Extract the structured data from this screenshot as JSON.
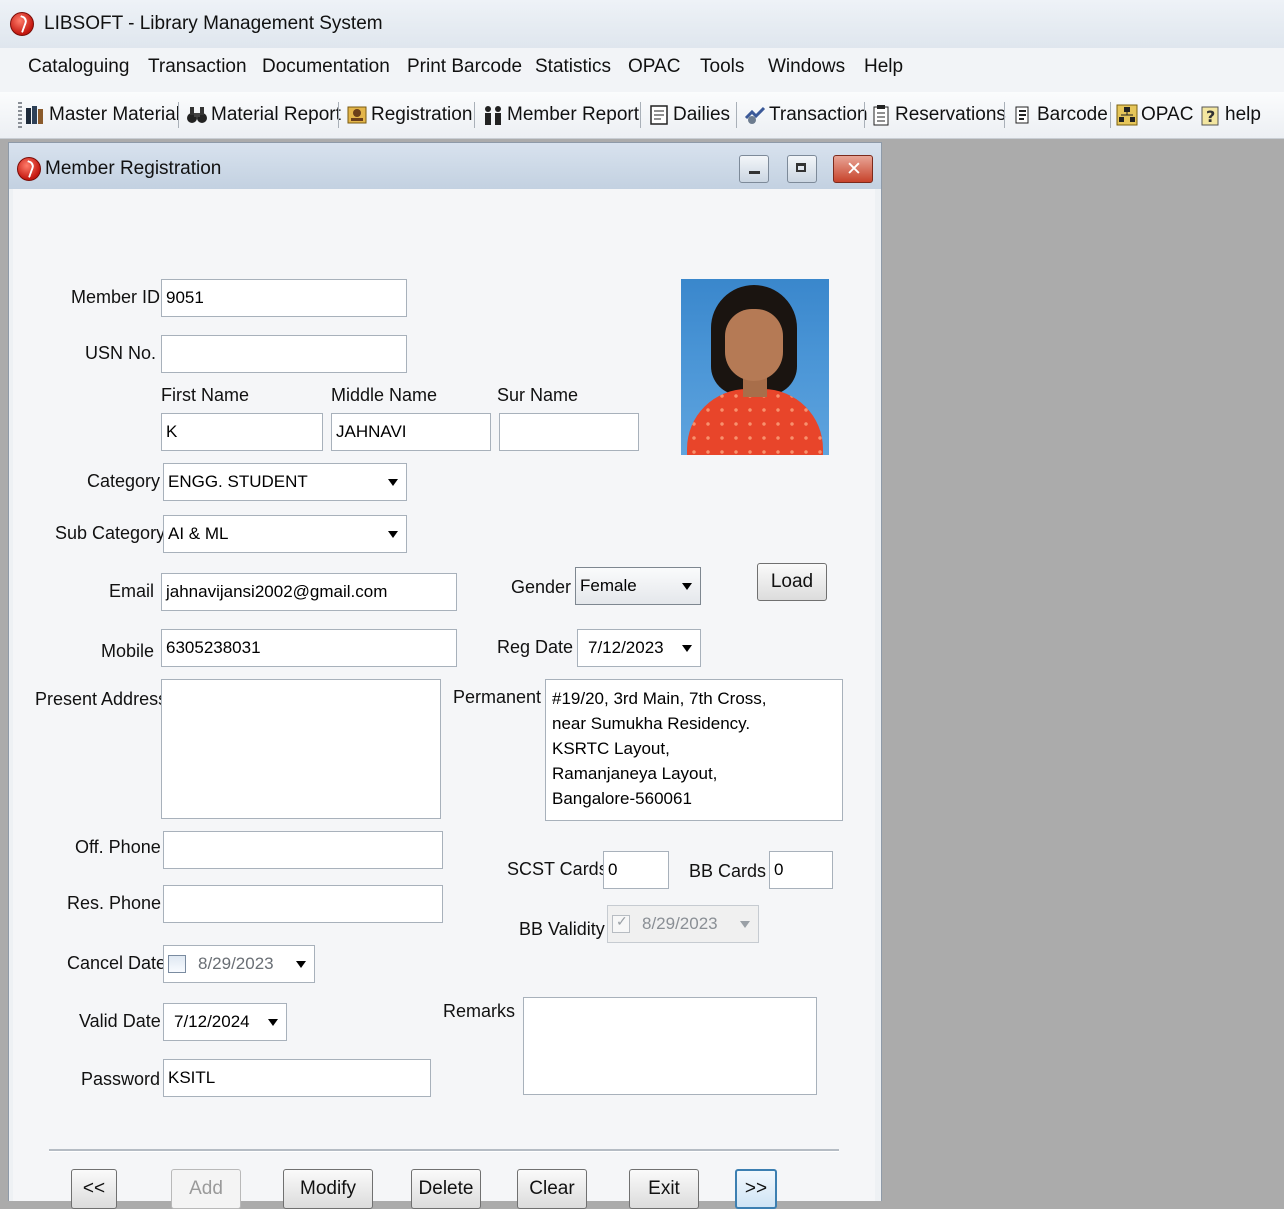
{
  "app": {
    "title": "LIBSOFT - Library Management System"
  },
  "menu": [
    "Cataloguing",
    "Transaction",
    "Documentation",
    "Print Barcode",
    "Statistics",
    "OPAC",
    "Tools",
    "Windows",
    "Help"
  ],
  "toolbar": [
    {
      "label": "Master Material",
      "icon": "master-material-icon"
    },
    {
      "label": "Material Report",
      "icon": "binoculars-icon"
    },
    {
      "label": "Registration",
      "icon": "registration-icon"
    },
    {
      "label": "Member Report",
      "icon": "members-icon"
    },
    {
      "label": "Dailies",
      "icon": "document-icon"
    },
    {
      "label": "Transaction",
      "icon": "transaction-icon"
    },
    {
      "label": "Reservations",
      "icon": "reservations-icon"
    },
    {
      "label": "Barcode",
      "icon": "barcode-icon"
    },
    {
      "label": "OPAC",
      "icon": "opac-icon"
    },
    {
      "label": "help",
      "icon": "help-icon"
    }
  ],
  "window": {
    "title": "Member Registration"
  },
  "form": {
    "member_id": {
      "label": "Member ID",
      "value": "9051"
    },
    "usn": {
      "label": "USN No.",
      "value": ""
    },
    "first_name": {
      "label": "First Name",
      "value": "K"
    },
    "middle_name": {
      "label": "Middle Name",
      "value": "JAHNAVI"
    },
    "sur_name": {
      "label": "Sur Name",
      "value": ""
    },
    "category": {
      "label": "Category",
      "value": "ENGG. STUDENT"
    },
    "sub_category": {
      "label": "Sub Category",
      "value": "AI & ML"
    },
    "email": {
      "label": "Email",
      "value": "jahnavijansi2002@gmail.com"
    },
    "gender": {
      "label": "Gender",
      "value": "Female"
    },
    "load_button": "Load",
    "mobile": {
      "label": "Mobile",
      "value": "6305238031"
    },
    "reg_date": {
      "label": "Reg Date",
      "value": "7/12/2023"
    },
    "present_address": {
      "label": "Present Address",
      "value": ""
    },
    "permanent": {
      "label": "Permanent",
      "value": "#19/20, 3rd Main, 7th Cross,\nnear Sumukha Residency.\nKSRTC Layout,\nRamanjaneya Layout,\nBangalore-560061"
    },
    "off_phone": {
      "label": "Off. Phone",
      "value": ""
    },
    "res_phone": {
      "label": "Res. Phone",
      "value": ""
    },
    "scst_cards": {
      "label": "SCST Cards",
      "value": "0"
    },
    "bb_cards": {
      "label": "BB Cards",
      "value": "0"
    },
    "bb_validity": {
      "label": "BB Validity",
      "value": "8/29/2023",
      "checked": true
    },
    "cancel_date": {
      "label": "Cancel Date",
      "value": "8/29/2023",
      "checked": false
    },
    "valid_date": {
      "label": "Valid Date",
      "value": "7/12/2024"
    },
    "remarks": {
      "label": "Remarks",
      "value": ""
    },
    "password": {
      "label": "Password",
      "value": "KSITL"
    }
  },
  "buttons": {
    "prev": "<<",
    "add": "Add",
    "modify": "Modify",
    "delete": "Delete",
    "clear": "Clear",
    "exit": "Exit",
    "next": ">>"
  }
}
